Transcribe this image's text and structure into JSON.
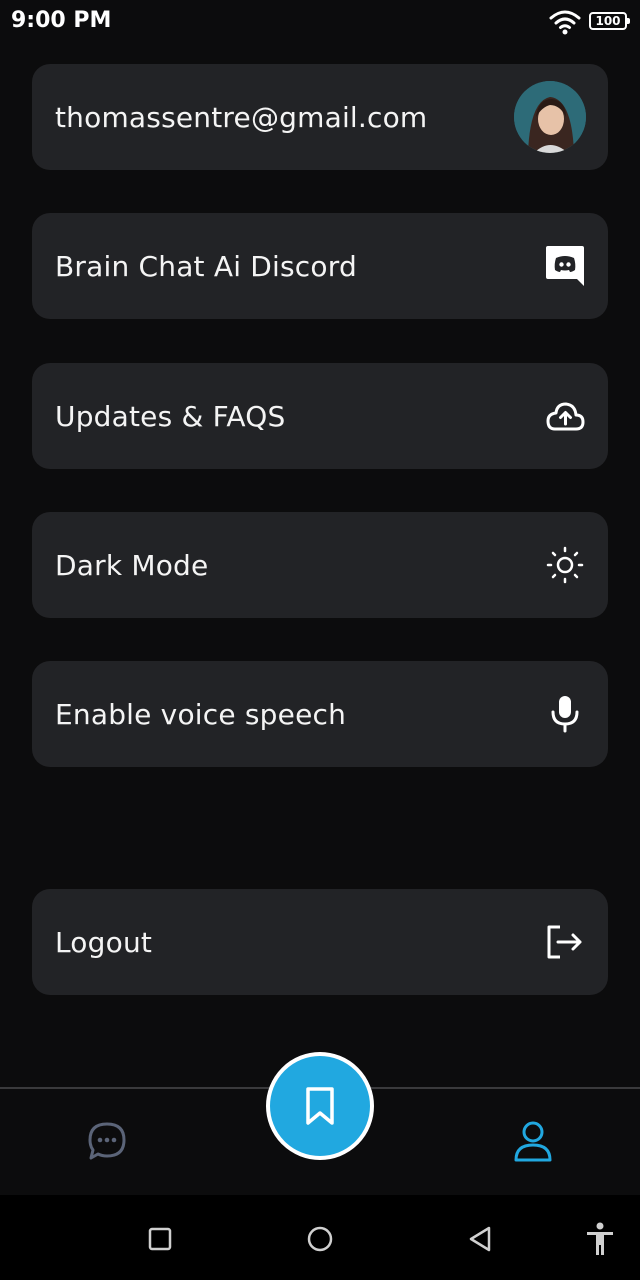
{
  "status_bar": {
    "time": "9:00 PM",
    "battery": "100"
  },
  "menu": {
    "account_email": "thomassentre@gmail.com",
    "items": [
      {
        "label": "Brain Chat Ai Discord",
        "icon": "discord-icon"
      },
      {
        "label": "Updates & FAQS",
        "icon": "cloud-upload-icon"
      },
      {
        "label": "Dark Mode",
        "icon": "sun-icon"
      },
      {
        "label": "Enable voice speech",
        "icon": "microphone-icon"
      }
    ],
    "logout_label": "Logout"
  },
  "bottom_nav": {
    "items": [
      "chat-icon",
      "bookmark-icon",
      "profile-icon"
    ],
    "active": "profile",
    "accent_color": "#21a8e0"
  },
  "system_nav": [
    "recent-apps",
    "home",
    "back",
    "accessibility"
  ]
}
